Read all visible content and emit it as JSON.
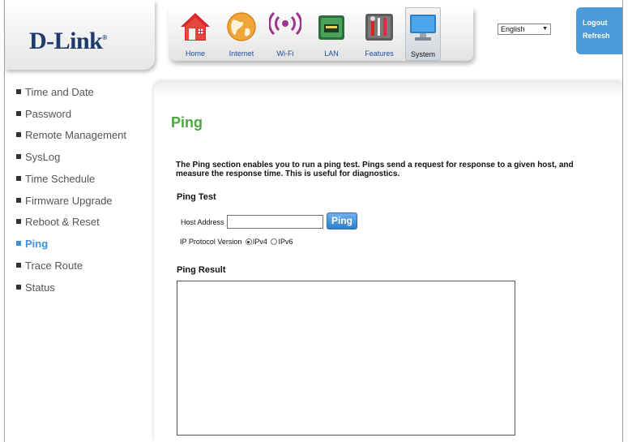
{
  "header": {
    "logo_text": "D-Link",
    "logo_mark": "®",
    "nav": [
      {
        "label": "Home",
        "icon": "home-icon"
      },
      {
        "label": "Internet",
        "icon": "globe-icon"
      },
      {
        "label": "Wi-Fi",
        "icon": "wifi-icon"
      },
      {
        "label": "LAN",
        "icon": "lan-icon"
      },
      {
        "label": "Features",
        "icon": "tools-icon"
      },
      {
        "label": "System",
        "icon": "monitor-icon"
      }
    ],
    "active_nav": "System",
    "language": "English",
    "logout_label": "Logout",
    "refresh_label": "Refresh"
  },
  "sidebar": {
    "items": [
      {
        "label": "Time and Date"
      },
      {
        "label": "Password"
      },
      {
        "label": "Remote Management"
      },
      {
        "label": "SysLog"
      },
      {
        "label": "Time Schedule"
      },
      {
        "label": "Firmware Upgrade"
      },
      {
        "label": "Reboot & Reset"
      },
      {
        "label": "Ping"
      },
      {
        "label": "Trace Route"
      },
      {
        "label": "Status"
      }
    ],
    "active": "Ping"
  },
  "main": {
    "title": "Ping",
    "intro": "The Ping section enables you to run a ping test. Pings send a request for response to a given host, and measure the response time. This is useful for diagnostics.",
    "ping_test_heading": "Ping Test",
    "host_label": "Host Address",
    "host_value": "",
    "ping_button": "Ping",
    "protocol_label": "IP Protocol Version",
    "protocol_options": [
      "IPv4",
      "IPv6"
    ],
    "protocol_selected": "IPv4",
    "result_heading": "Ping Result",
    "result_text": ""
  },
  "colors": {
    "brand_navy": "#1f3a6b",
    "accent_blue": "#4a9bd8",
    "title_green": "#4aa83c",
    "active_link": "#3d8fd8"
  }
}
